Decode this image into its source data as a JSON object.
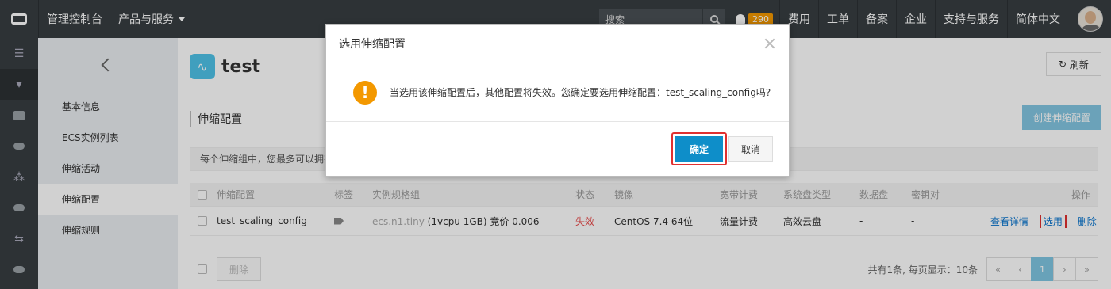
{
  "topbar": {
    "console": "管理控制台",
    "products": "产品与服务",
    "search_placeholder": "搜索",
    "badge": "290",
    "links": [
      "费用",
      "工单",
      "备案",
      "企业",
      "支持与服务",
      "简体中文"
    ]
  },
  "subnav": {
    "items": [
      "基本信息",
      "ECS实例列表",
      "伸缩活动",
      "伸缩配置",
      "伸缩规则"
    ],
    "active": "伸缩配置"
  },
  "main": {
    "title": "test",
    "refresh": "刷新",
    "section": "伸缩配置",
    "create": "创建伸缩配置",
    "info": "每个伸缩组中，您最多可以拥有"
  },
  "table": {
    "headers": [
      "伸缩配置",
      "标签",
      "实例规格组",
      "状态",
      "镜像",
      "宽带计费",
      "系统盘类型",
      "数据盘",
      "密钥对",
      "操作"
    ],
    "row": {
      "name": "test_scaling_config",
      "spec_a": "ecs.n1.tiny",
      "spec_b": " (1vcpu 1GB) 竞价 0.006",
      "status": "失效",
      "image": "CentOS 7.4 64位",
      "billing": "流量计费",
      "disk": "高效云盘",
      "data_disk": "-",
      "keypair": "-",
      "actions": [
        "查看详情",
        "选用",
        "删除"
      ]
    }
  },
  "footer": {
    "delete": "删除",
    "summary": "共有1条, 每页显示：10条",
    "pages": [
      "«",
      "‹",
      "1",
      "›",
      "»"
    ]
  },
  "dialog": {
    "title": "选用伸缩配置",
    "message": "当选用该伸缩配置后，其他配置将失效。您确定要选用伸缩配置：test_scaling_config吗?",
    "ok": "确定",
    "cancel": "取消"
  }
}
